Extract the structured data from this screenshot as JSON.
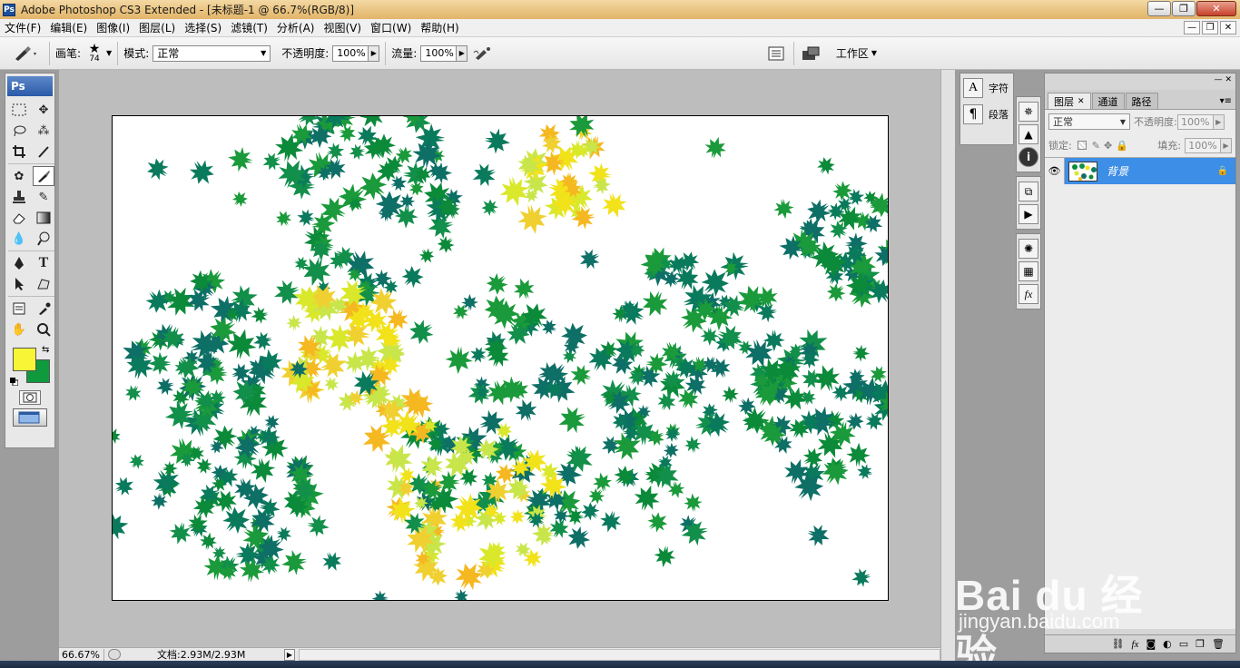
{
  "window": {
    "app_icon": "Ps",
    "title": "Adobe Photoshop CS3 Extended - [未标题-1 @ 66.7%(RGB/8)]",
    "controls": [
      "—",
      "❐",
      "✕"
    ]
  },
  "menu": {
    "items": [
      "文件(F)",
      "编辑(E)",
      "图像(I)",
      "图层(L)",
      "选择(S)",
      "滤镜(T)",
      "分析(A)",
      "视图(V)",
      "窗口(W)",
      "帮助(H)"
    ],
    "doc_controls": [
      "—",
      "❐",
      "✕"
    ]
  },
  "options": {
    "brush_label": "画笔:",
    "brush_size": "74",
    "mode_label": "模式:",
    "mode_value": "正常",
    "opacity_label": "不透明度:",
    "opacity_value": "100%",
    "flow_label": "流量:",
    "flow_value": "100%",
    "workspace_label": "工作区"
  },
  "toolbox": {
    "header": "Ps",
    "foreground_color": "#f7f536",
    "background_color": "#0f9a3e"
  },
  "status": {
    "zoom": "66.67%",
    "doc_info": "文档:2.93M/2.93M"
  },
  "dock": {
    "character_label": "字符",
    "paragraph_label": "段落"
  },
  "layers_panel": {
    "tabs": [
      "图层",
      "通道",
      "路径"
    ],
    "blend_mode": "正常",
    "opacity_label": "不透明度:",
    "opacity_value": "100%",
    "lock_label": "锁定:",
    "fill_label": "填充:",
    "fill_value": "100%",
    "layers": [
      {
        "name": "背景",
        "visible": true,
        "locked": true,
        "selected": true
      }
    ]
  },
  "watermark": {
    "main": "Bai du 经验",
    "sub": "jingyan.baidu.com"
  },
  "colors": {
    "leaf_greens": [
      "#0b8a3a",
      "#0a7a5c",
      "#128f4a",
      "#0e6f66",
      "#1a9a3a"
    ],
    "leaf_yellows": [
      "#f2e21a",
      "#d9e82a",
      "#f5b820",
      "#c8e64a",
      "#f0d030"
    ],
    "layer_selected": "#3d8ee6"
  }
}
